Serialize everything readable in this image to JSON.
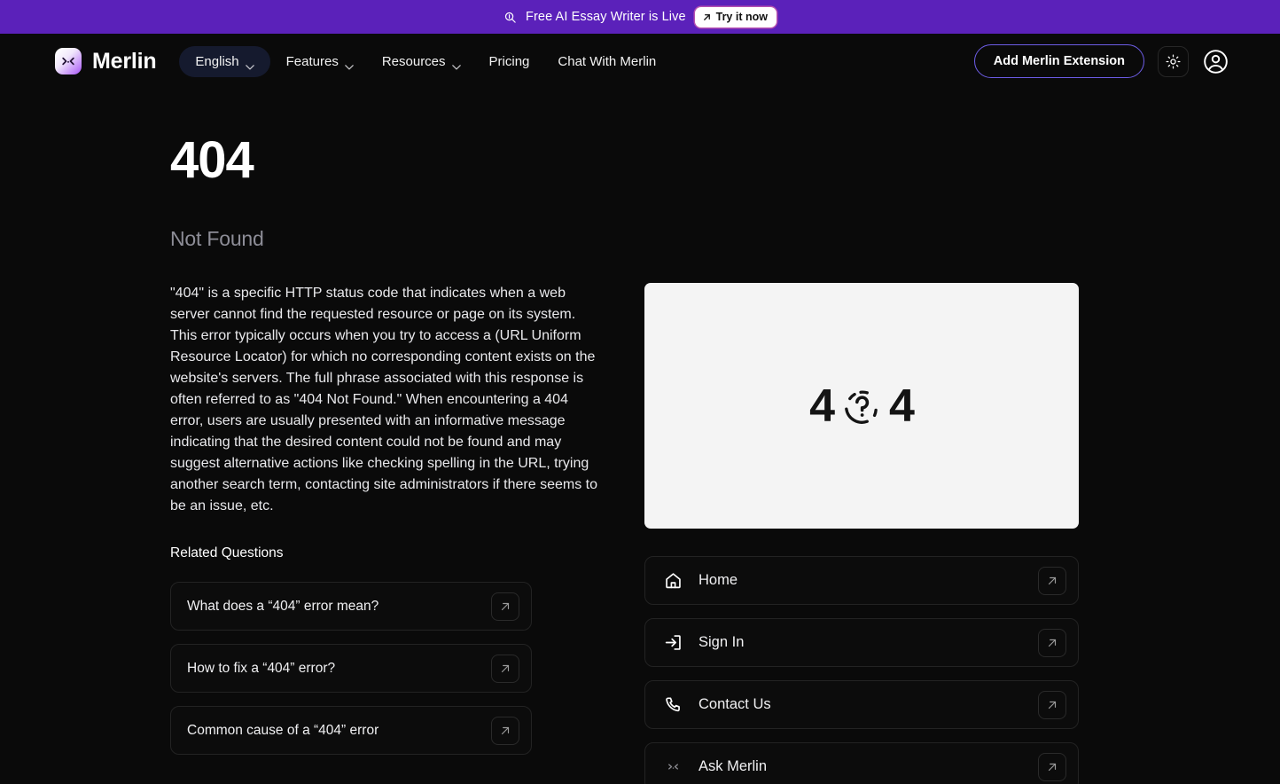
{
  "banner": {
    "icon": "search-sparkle-icon",
    "text": "Free AI Essay Writer is Live",
    "cta_label": "Try it now",
    "cta_icon": "arrow-up-right-icon",
    "bg_color": "#5b21ba"
  },
  "nav": {
    "brand_name": "Merlin",
    "brand_icon": "merlin-logo-icon",
    "links": [
      {
        "label": "English",
        "has_chevron": true,
        "active": true
      },
      {
        "label": "Features",
        "has_chevron": true,
        "active": false
      },
      {
        "label": "Resources",
        "has_chevron": true,
        "active": false
      },
      {
        "label": "Pricing",
        "has_chevron": false,
        "active": false
      },
      {
        "label": "Chat With Merlin",
        "has_chevron": false,
        "active": false
      }
    ],
    "extension_button": "Add Merlin Extension",
    "theme_icon": "sun-icon",
    "account_icon": "user-circle-icon",
    "accent_color": "#6d5de6"
  },
  "page": {
    "title": "404",
    "subtitle": "Not Found",
    "body": "\"404\" is a specific HTTP status code that indicates when a web server cannot find the requested resource or page on its system. This error typically occurs when you try to access a (URL Uniform Resource Locator) for which no corresponding content exists on the website's servers. The full phrase associated with this response is often referred to as \"404 Not Found.\" When encountering a 404 error, users are usually presented with an informative message indicating that the desired content could not be found and may suggest alternative actions like checking spelling in the URL, trying another search term, contacting site administrators if there seems to be an issue, etc.",
    "related_label": "Related Questions",
    "related_questions": [
      {
        "text": "What does a “404” error mean?",
        "action_icon": "arrow-up-right-icon"
      },
      {
        "text": "How to fix a “404” error?",
        "action_icon": "arrow-up-right-icon"
      },
      {
        "text": "Common cause of a “404” error",
        "action_icon": "arrow-up-right-icon"
      }
    ]
  },
  "hero": {
    "left_digit": "4",
    "right_digit": "4",
    "middle_icon": "dashed-circle-question-icon",
    "bg_color": "#f4f4f4"
  },
  "links": [
    {
      "label": "Home",
      "icon": "home-icon",
      "action_icon": "arrow-up-right-icon"
    },
    {
      "label": "Sign In",
      "icon": "login-icon",
      "action_icon": "arrow-up-right-icon"
    },
    {
      "label": "Contact Us",
      "icon": "phone-icon",
      "action_icon": "arrow-up-right-icon"
    },
    {
      "label": "Ask Merlin",
      "icon": "merlin-logo-icon",
      "action_icon": "arrow-up-right-icon"
    }
  ]
}
